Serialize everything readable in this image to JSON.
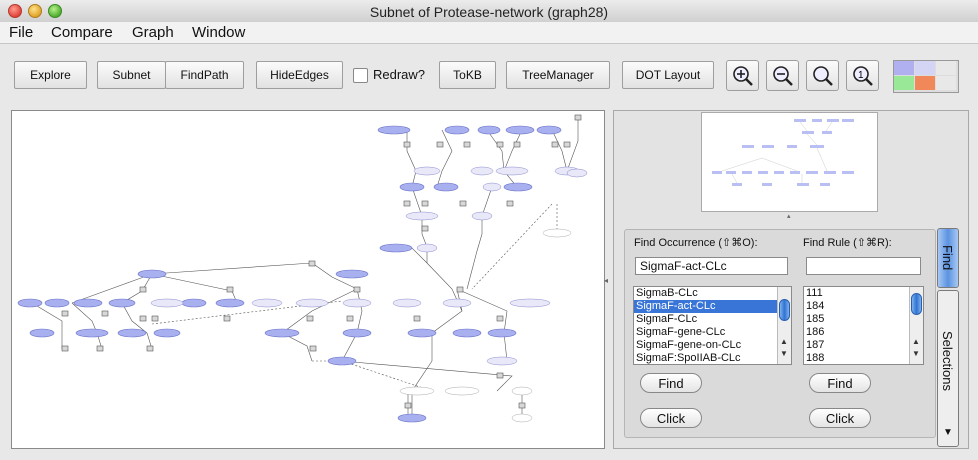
{
  "window": {
    "title": "Subnet of Protease-network (graph28)"
  },
  "menu": [
    "File",
    "Compare",
    "Graph",
    "Window"
  ],
  "toolbar": {
    "explore": "Explore",
    "subnet": "Subnet",
    "findpath": "FindPath",
    "hideedges": "HideEdges",
    "redraw": "Redraw?",
    "tokb": "ToKB",
    "treemanager": "TreeManager",
    "dotlayout": "DOT Layout",
    "zoom_icons": [
      "zoom-in-icon",
      "zoom-out-icon",
      "zoom-fit-icon",
      "zoom-reset-icon"
    ]
  },
  "colors": {
    "node": "#a9b0f0",
    "accent": "#3875d7",
    "swatches": [
      "#b0b0f0",
      "#d4d4f4",
      "#e8e8e8",
      "#98e898",
      "#f0885a",
      "#e8e8e8"
    ]
  },
  "find": {
    "occurrence_label": "Find Occurrence (⇧⌘O):",
    "rule_label": "Find Rule (⇧⌘R):",
    "occurrence_value": "SigmaF-act-CLc",
    "rule_value": "",
    "occurrences": [
      "SigmaB-CLc",
      "SigmaF-act-CLc",
      "SigmaF-CLc",
      "SigmaF-gene-CLc",
      "SigmaF-gene-on-CLc",
      "SigmaF:SpoIIAB-CLc"
    ],
    "selected_index": 1,
    "rules": [
      "111",
      "184",
      "185",
      "186",
      "187",
      "188"
    ],
    "find_button": "Find",
    "click_button": "Click"
  },
  "tabs": {
    "find": "Find",
    "selections": "Selections"
  }
}
